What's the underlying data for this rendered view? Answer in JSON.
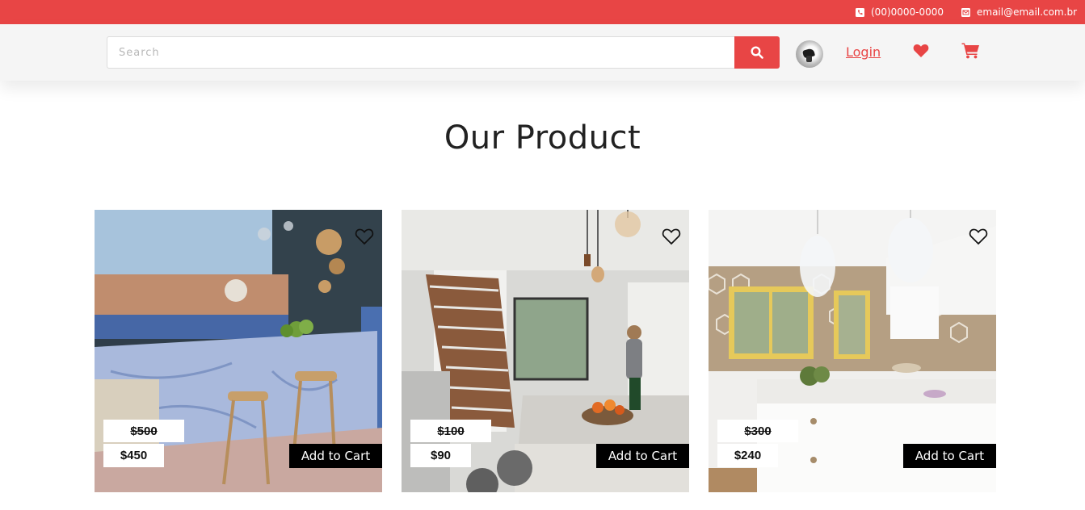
{
  "topbar": {
    "phone": "(00)0000-0000",
    "email": "email@email.com.br",
    "phone_icon": "phone-icon",
    "email_icon": "envelope-icon"
  },
  "header": {
    "search_placeholder": "Search",
    "search_icon": "search-icon",
    "login_label": "Login",
    "wishlist_icon": "heart-icon",
    "cart_icon": "cart-icon"
  },
  "main": {
    "title": "Our Product"
  },
  "products": [
    {
      "old_price": "$500",
      "new_price": "$450",
      "cta": "Add to Cart"
    },
    {
      "old_price": "$100",
      "new_price": "$90",
      "cta": "Add to Cart"
    },
    {
      "old_price": "$300",
      "new_price": "$240",
      "cta": "Add to Cart"
    }
  ],
  "colors": {
    "accent": "#e84545",
    "header_bg": "#f5f5f5",
    "button_dark": "#000000"
  }
}
